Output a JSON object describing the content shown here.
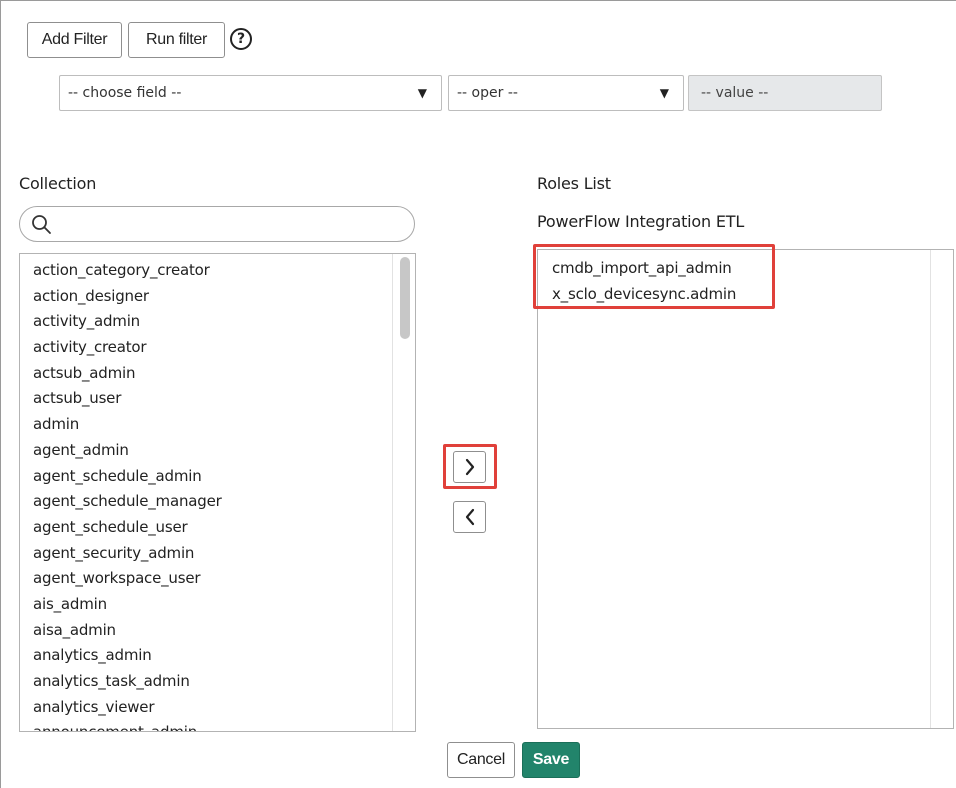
{
  "filter_bar": {
    "add_filter_label": "Add Filter",
    "run_filter_label": "Run filter",
    "help_glyph": "?",
    "choose_field_placeholder": "-- choose field --",
    "oper_placeholder": "-- oper --",
    "value_placeholder": "-- value --",
    "dropdown_arrow": "▼"
  },
  "collection": {
    "heading": "Collection",
    "search_value": "",
    "items": [
      "action_category_creator",
      "action_designer",
      "activity_admin",
      "activity_creator",
      "actsub_admin",
      "actsub_user",
      "admin",
      "agent_admin",
      "agent_schedule_admin",
      "agent_schedule_manager",
      "agent_schedule_user",
      "agent_security_admin",
      "agent_workspace_user",
      "ais_admin",
      "aisa_admin",
      "analytics_admin",
      "analytics_task_admin",
      "analytics_viewer",
      "announcement_admin"
    ]
  },
  "roles": {
    "heading": "Roles List",
    "subheading": "PowerFlow Integration ETL",
    "items": [
      "cmdb_import_api_admin",
      "x_sclo_devicesync.admin"
    ]
  },
  "actions": {
    "cancel_label": "Cancel",
    "save_label": "Save"
  },
  "colors": {
    "save_bg": "#22846b",
    "highlight": "#e0403a"
  },
  "icons": {
    "search": "search-icon",
    "move_right": "chevron-right-icon",
    "move_left": "chevron-left-icon",
    "help": "help-circle-icon"
  }
}
